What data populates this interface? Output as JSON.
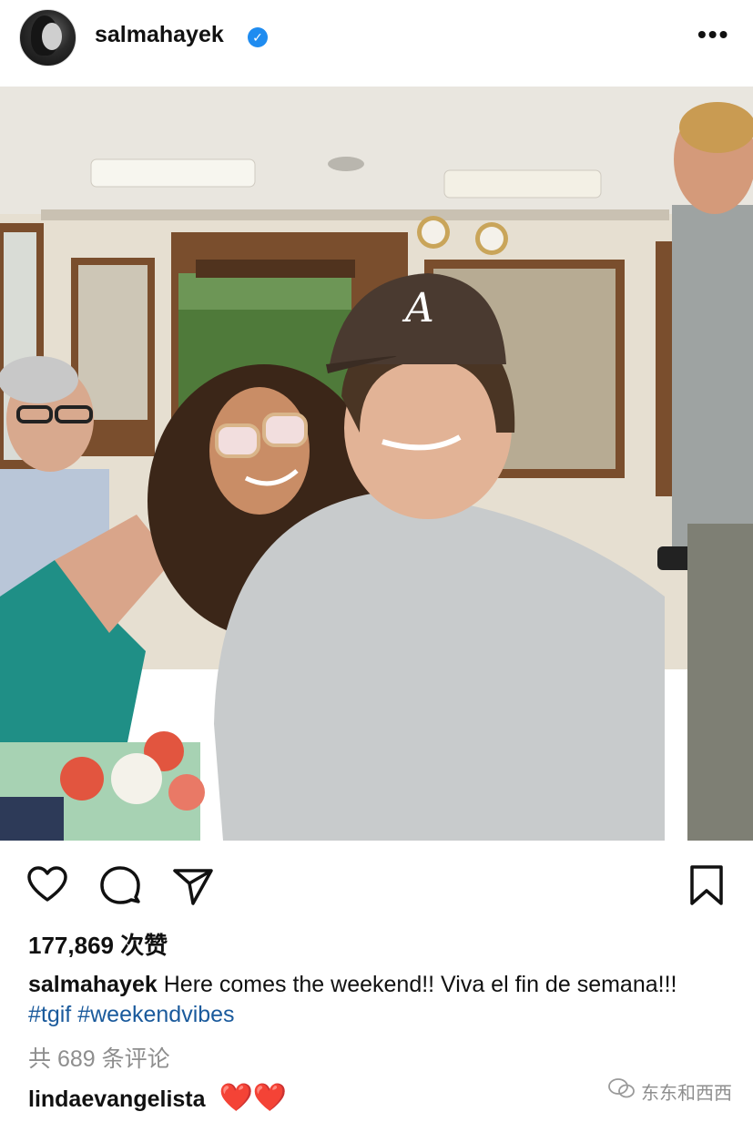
{
  "post": {
    "username": "salmahayek",
    "verified_mark": "✓",
    "more_label": "•••"
  },
  "icons": {
    "like": "heart-icon",
    "comment": "comment-bubble-icon",
    "share": "paper-plane-icon",
    "save": "bookmark-icon"
  },
  "engagement": {
    "likes_text": "177,869 次赞"
  },
  "caption": {
    "username": "salmahayek",
    "text": "Here comes the weekend!! Viva el fin de semana!!!",
    "hashtag_1": "#tgif",
    "hashtag_2": "#weekendvibes"
  },
  "comments": {
    "count_text": "共 689 条评论",
    "first_user": "lindaevangelista",
    "first_text": "❤️❤️"
  },
  "watermark": {
    "text": "东东和西西"
  },
  "colors": {
    "verified": "#1f8cf0",
    "hashtag": "#1a5a9c",
    "muted": "#8e8e8e",
    "heart": "#c8102e"
  }
}
